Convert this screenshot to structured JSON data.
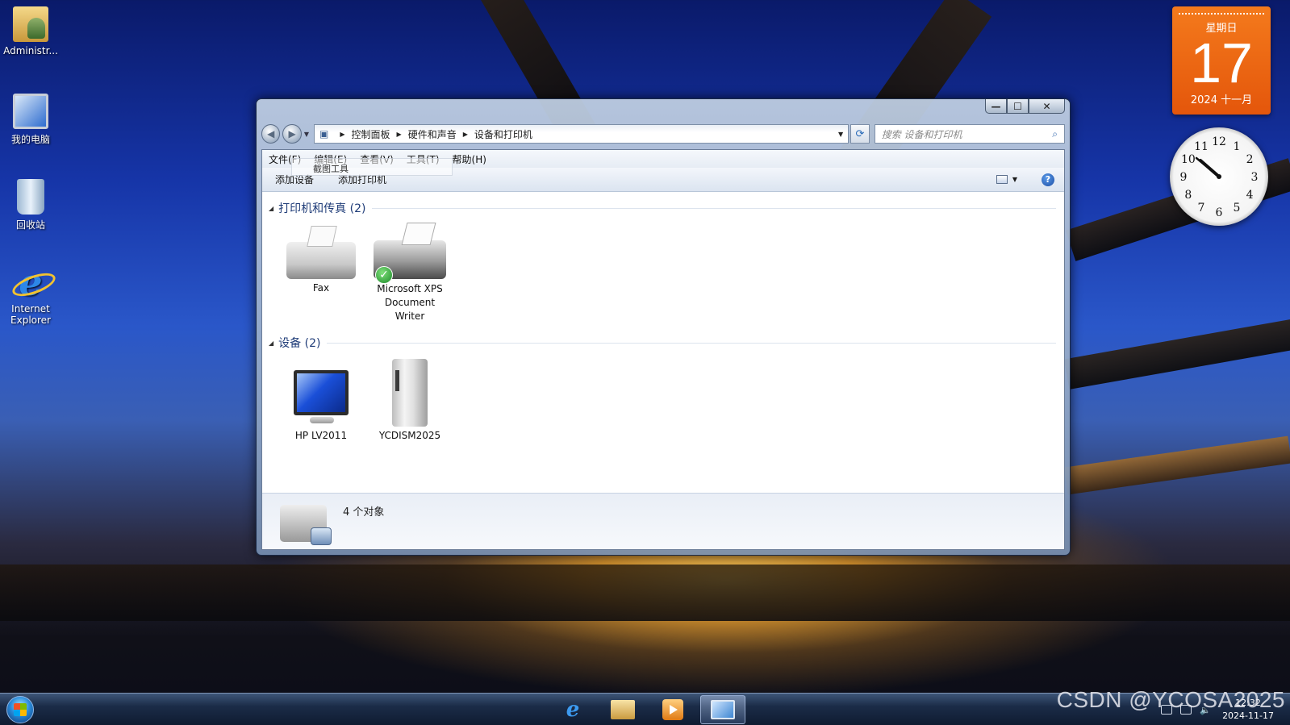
{
  "desktop": {
    "icons": [
      {
        "label": "Administr..."
      },
      {
        "label": "我的电脑"
      },
      {
        "label": "回收站"
      },
      {
        "label": "Internet Explorer"
      }
    ]
  },
  "calendar": {
    "weekday": "星期日",
    "day": "17",
    "year_month": "2024 十一月"
  },
  "clock": {
    "numerals": [
      "12",
      "1",
      "2",
      "3",
      "4",
      "5",
      "6",
      "7",
      "8",
      "9",
      "10",
      "11"
    ]
  },
  "window": {
    "breadcrumb": [
      "控制面板",
      "硬件和声音",
      "设备和打印机"
    ],
    "search_placeholder": "搜索 设备和打印机",
    "menu": [
      "文件(F)",
      "编辑(E)",
      "查看(V)",
      "工具(T)",
      "帮助(H)"
    ],
    "tooltip_ghost": "截图工具",
    "toolbar": {
      "add_device": "添加设备",
      "add_printer": "添加打印机",
      "help": "?"
    },
    "groups": [
      {
        "title": "打印机和传真 (2)",
        "items": [
          {
            "label": "Fax",
            "icon": "fax-icon"
          },
          {
            "label": "Microsoft XPS Document Writer",
            "icon": "printer-icon",
            "default": true
          }
        ]
      },
      {
        "title": "设备 (2)",
        "items": [
          {
            "label": "HP LV2011",
            "icon": "monitor-icon"
          },
          {
            "label": "YCDISM2025",
            "icon": "computer-tower-icon"
          }
        ]
      }
    ],
    "details": {
      "count": "4 个对象"
    }
  },
  "taskbar": {
    "tray_time": "12:32",
    "tray_date": "2024-11-17"
  },
  "watermark": "CSDN @YCOSA2025"
}
